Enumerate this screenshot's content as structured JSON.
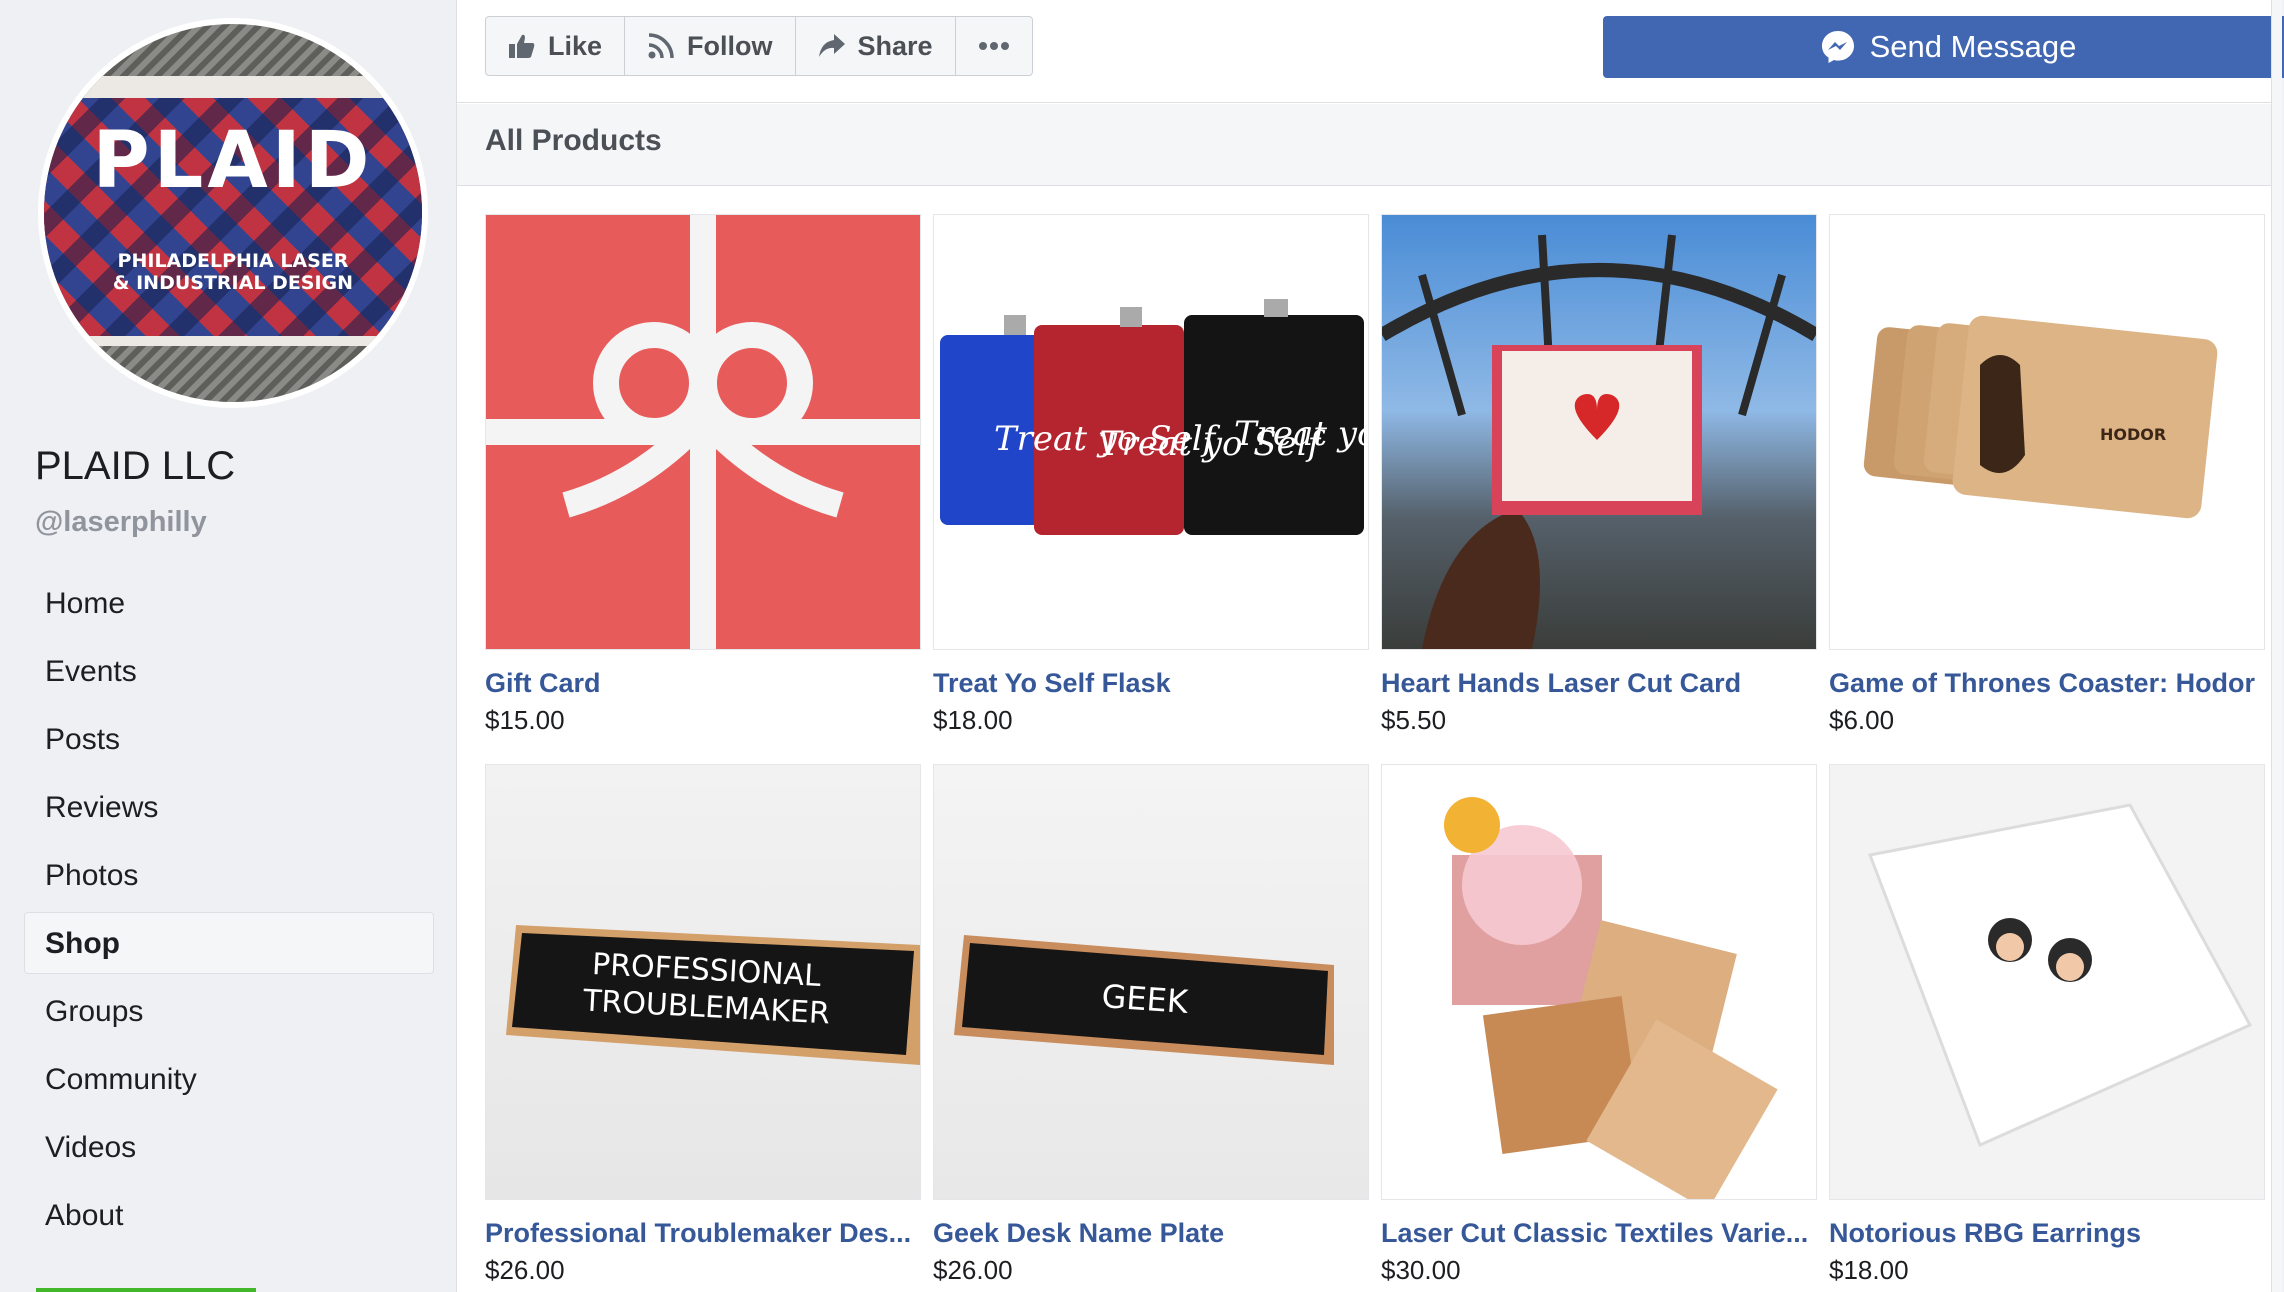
{
  "sidebar": {
    "avatar": {
      "logo_word": "PLAID",
      "logo_sub_1": "PHILADELPHIA LASER",
      "logo_sub_2": "& INDUSTRIAL DESIGN"
    },
    "page_name": "PLAID LLC",
    "handle": "@laserphilly",
    "nav": [
      {
        "label": "Home"
      },
      {
        "label": "Events"
      },
      {
        "label": "Posts"
      },
      {
        "label": "Reviews"
      },
      {
        "label": "Photos"
      },
      {
        "label": "Shop",
        "active": true
      },
      {
        "label": "Groups"
      },
      {
        "label": "Community"
      },
      {
        "label": "Videos"
      },
      {
        "label": "About"
      }
    ]
  },
  "actions": {
    "like": "Like",
    "follow": "Follow",
    "share": "Share",
    "more": "...",
    "send_message": "Send Message"
  },
  "section": {
    "title": "All Products"
  },
  "products": [
    {
      "name": "Gift Card",
      "price": "$15.00",
      "image": "gift-card-image"
    },
    {
      "name": "Treat Yo Self Flask",
      "price": "$18.00",
      "image": "flask-image",
      "image_text": "Treat yo Self"
    },
    {
      "name": "Heart Hands Laser Cut Card",
      "price": "$5.50",
      "image": "heart-card-image"
    },
    {
      "name": "Game of Thrones Coaster: Hodor",
      "price": "$6.00",
      "image": "coaster-image",
      "image_text": "HODOR"
    },
    {
      "name": "Professional Troublemaker Des...",
      "price": "$26.00",
      "image": "nameplate-image",
      "image_text_1": "PROFESSIONAL",
      "image_text_2": "TROUBLEMAKER"
    },
    {
      "name": "Geek Desk Name Plate",
      "price": "$26.00",
      "image": "geek-nameplate-image",
      "image_text": "GEEK"
    },
    {
      "name": "Laser Cut Classic Textiles Varie...",
      "price": "$30.00",
      "image": "textile-coasters-image"
    },
    {
      "name": "Notorious RBG Earrings",
      "price": "$18.00",
      "image": "earrings-image"
    }
  ],
  "colors": {
    "brand_blue": "#4267b2",
    "link_blue": "#365899",
    "gift_red": "#e85b5b",
    "active_green": "#42b72a"
  }
}
